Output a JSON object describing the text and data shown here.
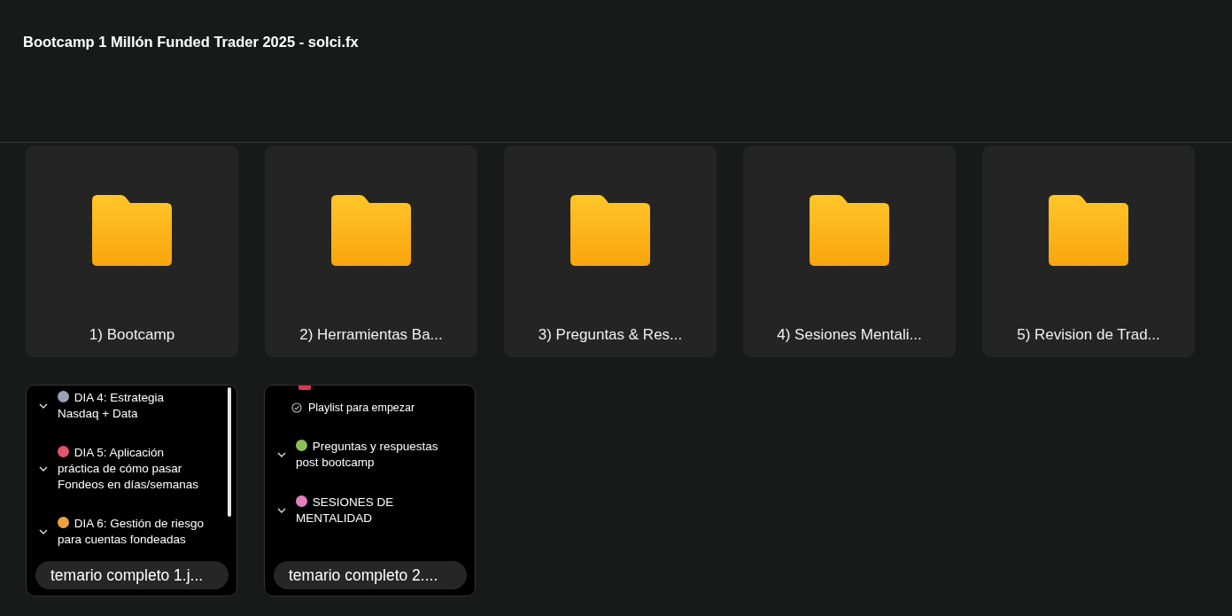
{
  "header": {
    "title": "Bootcamp 1 Millón Funded Trader 2025 - solci.fx"
  },
  "folders": [
    {
      "label": "1) Bootcamp"
    },
    {
      "label": "2) Herramientas Ba..."
    },
    {
      "label": "3) Preguntas & Res..."
    },
    {
      "label": "4) Sesiones Mentali..."
    },
    {
      "label": "5) Revision de Trad..."
    }
  ],
  "files": [
    {
      "label": "temario completo 1.j...",
      "scrollbar": true,
      "entries": [
        {
          "kind": "section",
          "color": "#9aa3b5",
          "text": "DIA 4: Estrategia Nasdaq + Data"
        },
        {
          "kind": "section",
          "color": "#e0566a",
          "text": "DIA 5: Aplicación práctica de cómo pasar Fondeos en días/semanas"
        },
        {
          "kind": "section",
          "color": "#e8a33c",
          "text": "DIA 6: Gestión de riesgo para cuentas fondeadas"
        }
      ]
    },
    {
      "label": "temario completo 2....",
      "scrollbar": false,
      "entries": [
        {
          "kind": "item",
          "text": "Playlist para empezar"
        },
        {
          "kind": "section",
          "color": "#8fbf5a",
          "text": "Preguntas y respuestas post bootcamp"
        },
        {
          "kind": "section",
          "color": "#e37fc0",
          "text": "SESIONES DE MENTALIDAD"
        }
      ]
    }
  ]
}
